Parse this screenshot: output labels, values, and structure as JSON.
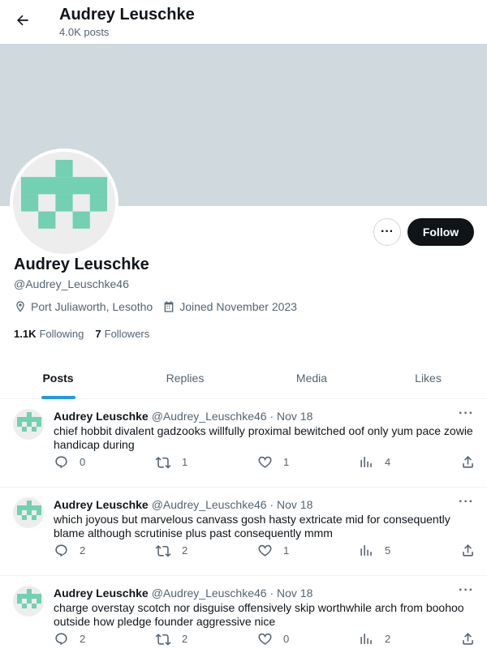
{
  "header": {
    "name": "Audrey Leuschke",
    "posts_count": "4.0K posts"
  },
  "profile": {
    "name": "Audrey Leuschke",
    "handle": "@Audrey_Leuschke46",
    "location": "Port Juliaworth, Lesotho",
    "joined": "Joined November 2023",
    "following_count": "1.1K",
    "following_label": "Following",
    "followers_count": "7",
    "followers_label": "Followers",
    "follow_label": "Follow",
    "more_label": "···",
    "avatar_color": "#73d0b2",
    "banner_color": "#cfd9de"
  },
  "tabs": [
    {
      "label": "Posts",
      "active": true
    },
    {
      "label": "Replies"
    },
    {
      "label": "Media"
    },
    {
      "label": "Likes"
    }
  ],
  "posts": [
    {
      "name": "Audrey Leuschke",
      "handle": "@Audrey_Leuschke46",
      "sep": "·",
      "date": "Nov 18",
      "text": "chief hobbit divalent gadzooks willfully proximal bewitched oof only yum pace zowie handicap during",
      "replies": "0",
      "reposts": "1",
      "likes": "1",
      "views": "4"
    },
    {
      "name": "Audrey Leuschke",
      "handle": "@Audrey_Leuschke46",
      "sep": "·",
      "date": "Nov 18",
      "text": "which joyous but marvelous canvass gosh hasty extricate mid for consequently blame although scrutinise plus past consequently mmm",
      "replies": "2",
      "reposts": "2",
      "likes": "1",
      "views": "5"
    },
    {
      "name": "Audrey Leuschke",
      "handle": "@Audrey_Leuschke46",
      "sep": "·",
      "date": "Nov 18",
      "text": "charge overstay scotch nor disguise offensively skip worthwhile arch from boohoo outside how pledge founder aggressive nice",
      "replies": "2",
      "reposts": "2",
      "likes": "0",
      "views": "2"
    }
  ],
  "post_more_label": "···",
  "icons": {
    "back": "arrow-left-icon",
    "location": "location-pin-icon",
    "calendar": "calendar-icon",
    "reply": "reply-icon",
    "repost": "repost-icon",
    "like": "heart-icon",
    "views": "views-chart-icon",
    "share": "share-icon"
  }
}
